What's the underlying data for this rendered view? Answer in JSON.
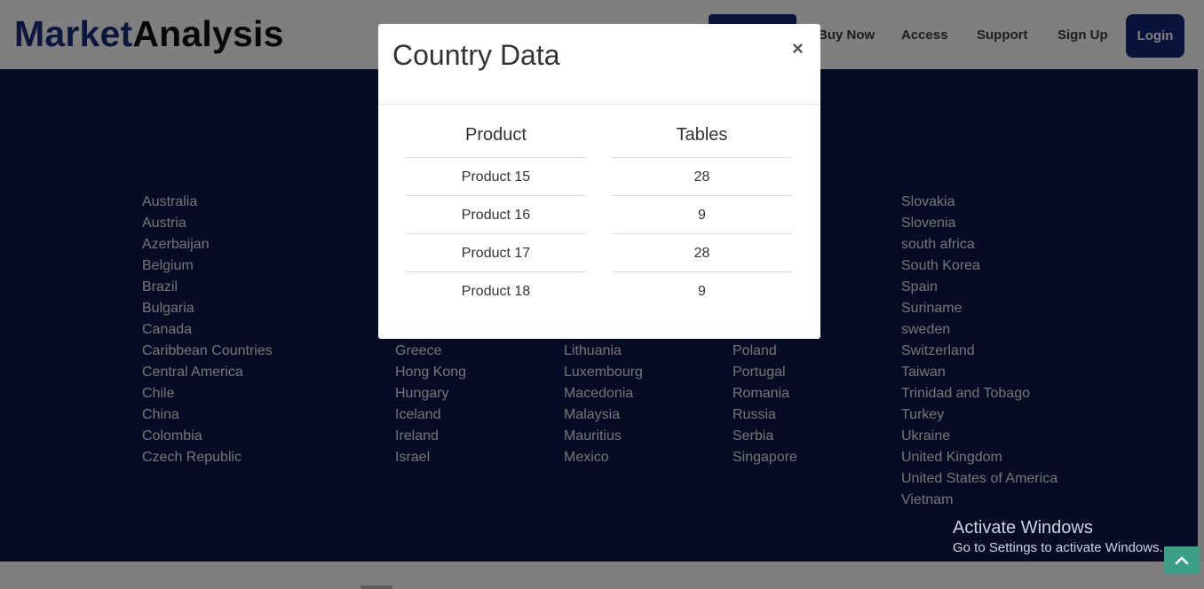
{
  "header": {
    "logo_part1": "Market",
    "logo_part2": "Analysis",
    "nav": [
      "Buy Now",
      "Access",
      "Support",
      "Sign Up"
    ],
    "login_label": "Login"
  },
  "countries": {
    "col1": [
      "Australia",
      "Austria",
      "Azerbaijan",
      "Belgium",
      "Brazil",
      "Bulgaria",
      "Canada",
      "Caribbean Countries",
      "Central America",
      "Chile",
      "China",
      "Colombia",
      "Czech Republic"
    ],
    "col2": [
      "Greece",
      "Hong Kong",
      "Hungary",
      "Iceland",
      "Ireland",
      "Israel"
    ],
    "col3": [
      "Lithuania",
      "Luxembourg",
      "Macedonia",
      "Malaysia",
      "Mauritius",
      "Mexico"
    ],
    "col4": [
      "Poland",
      "Portugal",
      "Romania",
      "Russia",
      "Serbia",
      "Singapore"
    ],
    "col5": [
      "Slovakia",
      "Slovenia",
      "south africa",
      "South Korea",
      "Spain",
      "Suriname",
      "sweden",
      "Switzerland",
      "Taiwan",
      "Trinidad and Tobago",
      "Turkey",
      "Ukraine",
      "United Kingdom",
      "United States of America",
      "Vietnam"
    ]
  },
  "modal": {
    "title": "Country Data",
    "close": "×",
    "columns": [
      "Product",
      "Tables"
    ],
    "rows": [
      {
        "product": "Product 15",
        "tables": "28"
      },
      {
        "product": "Product 16",
        "tables": "9"
      },
      {
        "product": "Product 17",
        "tables": "28"
      },
      {
        "product": "Product 18",
        "tables": "9"
      }
    ]
  },
  "watermark": {
    "line1": "Activate Windows",
    "line2": "Go to Settings to activate Windows."
  },
  "icons": {
    "close": "close-icon",
    "scroll_top": "chevron-up-icon"
  },
  "colors": {
    "brand_navy": "#13287a",
    "section_bg": "#0d1947",
    "scroll_top_bg": "#3f9e86"
  }
}
